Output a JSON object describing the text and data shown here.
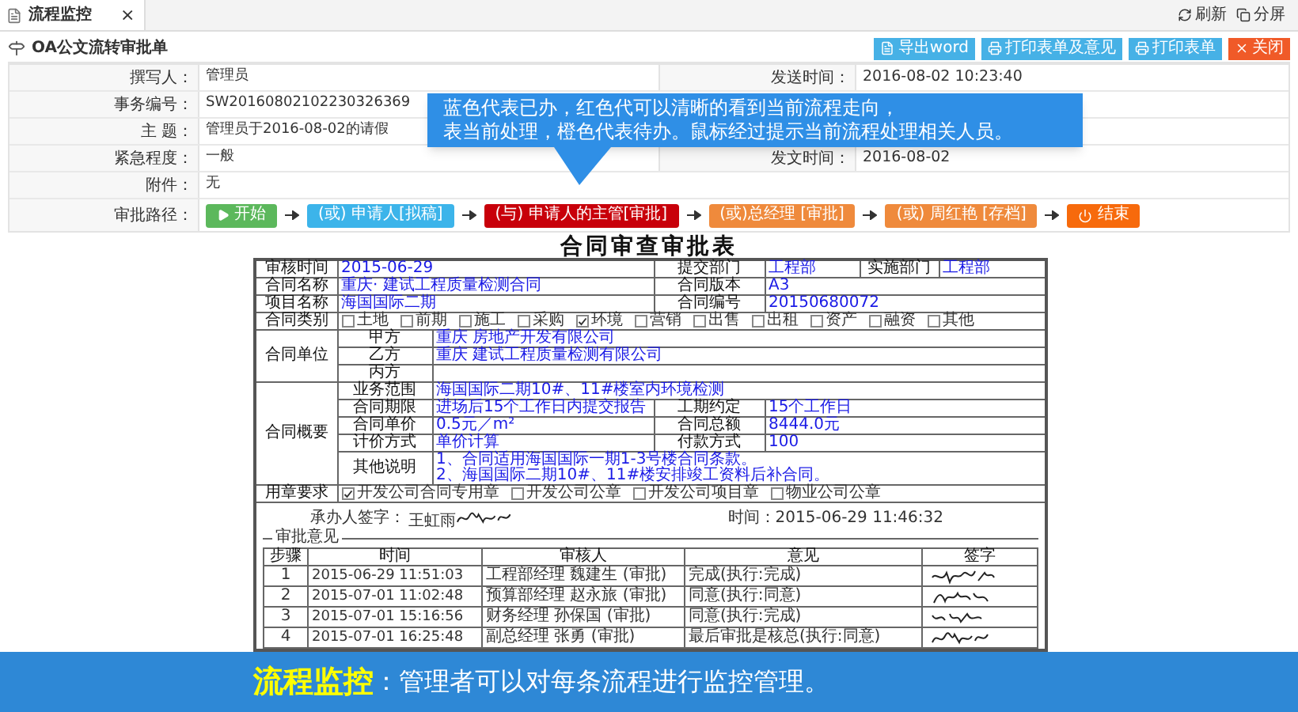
{
  "tab": {
    "title": "流程监控",
    "close": "×"
  },
  "toolbar_links": [
    {
      "label": "刷新",
      "kind": "refresh"
    },
    {
      "label": "分屏",
      "kind": "split"
    }
  ],
  "form": {
    "title": "OA公文流转审批单",
    "buttons": [
      {
        "label": "导出word",
        "kind": "export"
      },
      {
        "label": "打印表单及意见",
        "kind": "print"
      },
      {
        "label": "打印表单",
        "kind": "print"
      },
      {
        "label": "关闭",
        "kind": "close"
      }
    ],
    "fields": [
      {
        "label": "撰写人：",
        "value": "管理员",
        "right_label": "发送时间：",
        "right_value": "2016-08-02 10:23:40"
      },
      {
        "label": "事务编号：",
        "value": "SW20160802102230326369"
      },
      {
        "label": "主 题：",
        "value": "管理员于2016-08-02的请假"
      },
      {
        "label": "紧急程度：",
        "value": "一般",
        "right_label": "发文时间：",
        "right_value": "2016-08-02"
      },
      {
        "label": "附件：",
        "value": "无"
      }
    ],
    "path_label": "审批路径：",
    "steps": [
      {
        "label": "开始",
        "kind": "start"
      },
      {
        "label": "(或) 申请人[拟稿]",
        "kind": "done"
      },
      {
        "label": "(与) 申请人的主管[审批]",
        "kind": "current"
      },
      {
        "label": "(或)总经理 [审批]",
        "kind": "pending"
      },
      {
        "label": "(或) 周红艳 [存档]",
        "kind": "pending"
      },
      {
        "label": "结束",
        "kind": "end"
      }
    ]
  },
  "tooltip": [
    "蓝色代表已办，红色代可以清晰的看到当前流程走向，",
    "表当前处理，橙色代表待办。鼠标经过提示当前流程处理相关人员。"
  ],
  "document": {
    "title": "合同审查审批表",
    "header": [
      {
        "label": "审核时间",
        "value": "2015-06-29"
      },
      {
        "label": "提交部门",
        "value": "工程部"
      },
      {
        "label": "实施部门",
        "value": "工程部"
      }
    ],
    "rows": [
      {
        "label": "合同名称",
        "value": "重庆·  建试工程质量检测合同",
        "right_label": "合同版本",
        "right_value": "A3"
      },
      {
        "label": "项目名称",
        "value": "海国国际二期",
        "right_label": "合同编号",
        "right_value": "20150680072"
      }
    ],
    "contract_type": {
      "label": "合同类别",
      "options": [
        {
          "label": "土地",
          "checked": false
        },
        {
          "label": "前期",
          "checked": false
        },
        {
          "label": "施工",
          "checked": false
        },
        {
          "label": "采购",
          "checked": false
        },
        {
          "label": "环境",
          "checked": true
        },
        {
          "label": "营销",
          "checked": false
        },
        {
          "label": "出售",
          "checked": false
        },
        {
          "label": "出租",
          "checked": false
        },
        {
          "label": "资产",
          "checked": false
        },
        {
          "label": "融资",
          "checked": false
        },
        {
          "label": "其他",
          "checked": false
        }
      ]
    },
    "parties": {
      "label": "合同单位",
      "rows": [
        {
          "label": "甲方",
          "value": "重庆    房地产开发有限公司"
        },
        {
          "label": "乙方",
          "value": "重庆    建试工程质量检测有限公司"
        },
        {
          "label": "丙方"
        }
      ]
    },
    "terms": {
      "label": "合同概要",
      "rows": [
        {
          "label": "业务范围",
          "lines": [
            "海国国际二期10#、11#楼室内环境检测"
          ]
        },
        {
          "label": "合同期限",
          "lines": [
            "进场后15个工作日内提交报告"
          ],
          "right_label": "工期约定",
          "right_value": "15个工作日"
        },
        {
          "label": "合同单价",
          "lines": [
            "0.5元／m²"
          ],
          "right_label": "合同总额",
          "right_value": "8444.0元"
        },
        {
          "label": "计价方式",
          "lines": [
            "单价计算"
          ],
          "right_label": "付款方式",
          "right_value": "100"
        },
        {
          "label": "其他说明",
          "lines": [
            "1、合同适用海国国际一期1-3号楼合同条款。",
            "2、海国国际二期10#、11#楼安排竣工资料后补合同。"
          ]
        }
      ]
    },
    "seal": {
      "label": "用章要求",
      "options": [
        {
          "label": "开发公司合同专用章",
          "checked": true
        },
        {
          "label": "开发公司公章",
          "checked": false
        },
        {
          "label": "开发公司项目章",
          "checked": false
        },
        {
          "label": "物业公司公章",
          "checked": false
        }
      ]
    },
    "signer": {
      "label": "承办人签字：",
      "name": "王虹雨",
      "time": "时间：2015-06-29 11:46:32"
    },
    "approvals": {
      "legend": "审批意见",
      "columns": [
        "步骤",
        "时间",
        "审核人",
        "意见",
        "签字"
      ],
      "rows": [
        {
          "step": "1",
          "time": "2015-06-29 11:51:03",
          "reviewer": "工程部经理 魏建生 (审批)",
          "opinion": "完成(执行:完成)"
        },
        {
          "step": "2",
          "time": "2015-07-01 11:02:48",
          "reviewer": "预算部经理 赵永旅 (审批)",
          "opinion": "同意(执行:同意)"
        },
        {
          "step": "3",
          "time": "2015-07-01 15:16:56",
          "reviewer": "财务经理 孙保国 (审批)",
          "opinion": "同意(执行:完成)"
        },
        {
          "step": "4",
          "time": "2015-07-01 16:25:48",
          "reviewer": "副总经理 张勇 (审批)",
          "opinion": "最后审批是核总(执行:同意)"
        }
      ]
    }
  },
  "banner": {
    "title": "流程监控",
    "text": "：管理者可以对每条流程进行监控管理。"
  }
}
